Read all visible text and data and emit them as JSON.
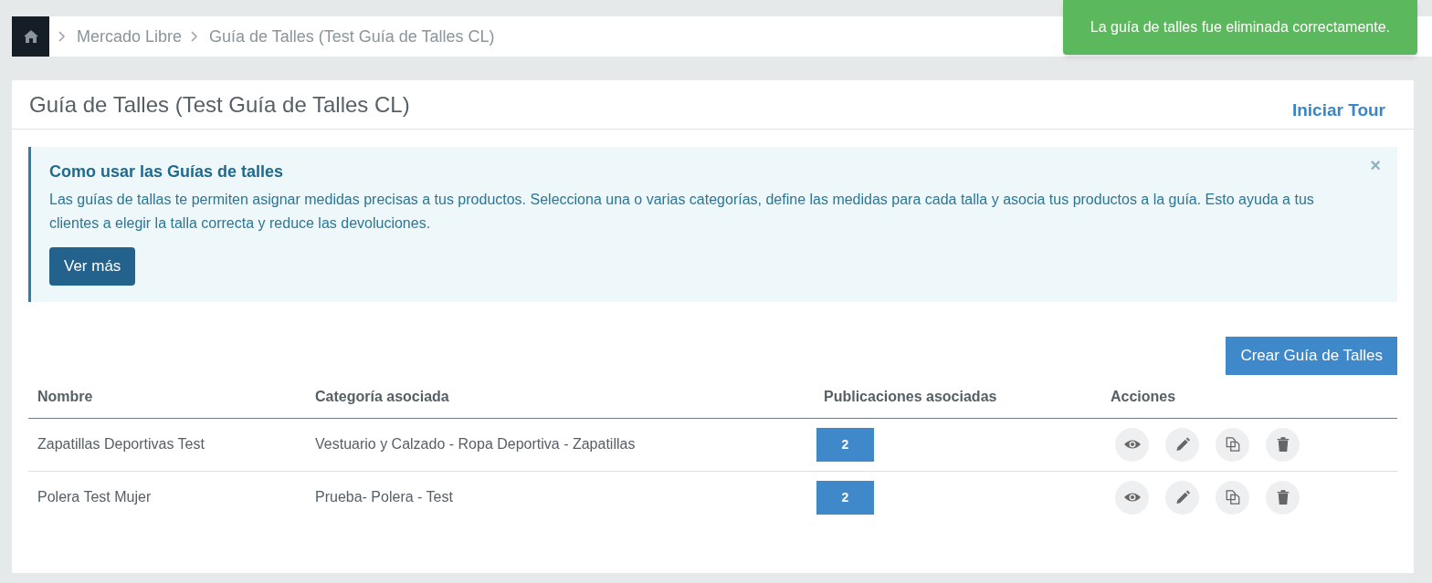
{
  "breadcrumb": [
    "Mercado Libre",
    "Guía de Talles (Test Guía de Talles CL)"
  ],
  "toast": "La guía de talles fue eliminada correctamente.",
  "card": {
    "title": "Guía de Talles (Test Guía de Talles CL)",
    "tour_link": "Iniciar Tour"
  },
  "alert": {
    "title": "Como usar las Guías de talles",
    "close": "×",
    "text": "Las guías de tallas te permiten asignar medidas precisas a tus productos. Selecciona una o varias categorías, define las medidas para cada talla y asocia tus productos a la guía. Esto ayuda a tus clientes a elegir la talla correcta y reduce las devoluciones.",
    "button": "Ver más"
  },
  "create_button": "Crear Guía de Talles",
  "table": {
    "columns": [
      "Nombre",
      "Categoría asociada",
      "Publicaciones asociadas",
      "Acciones"
    ],
    "rows": [
      {
        "name": "Zapatillas Deportivas Test",
        "category": "Vestuario y Calzado - Ropa Deportiva - Zapatillas",
        "publications": "2"
      },
      {
        "name": "Polera Test Mujer",
        "category": "Prueba- Polera - Test",
        "publications": "2"
      }
    ]
  }
}
